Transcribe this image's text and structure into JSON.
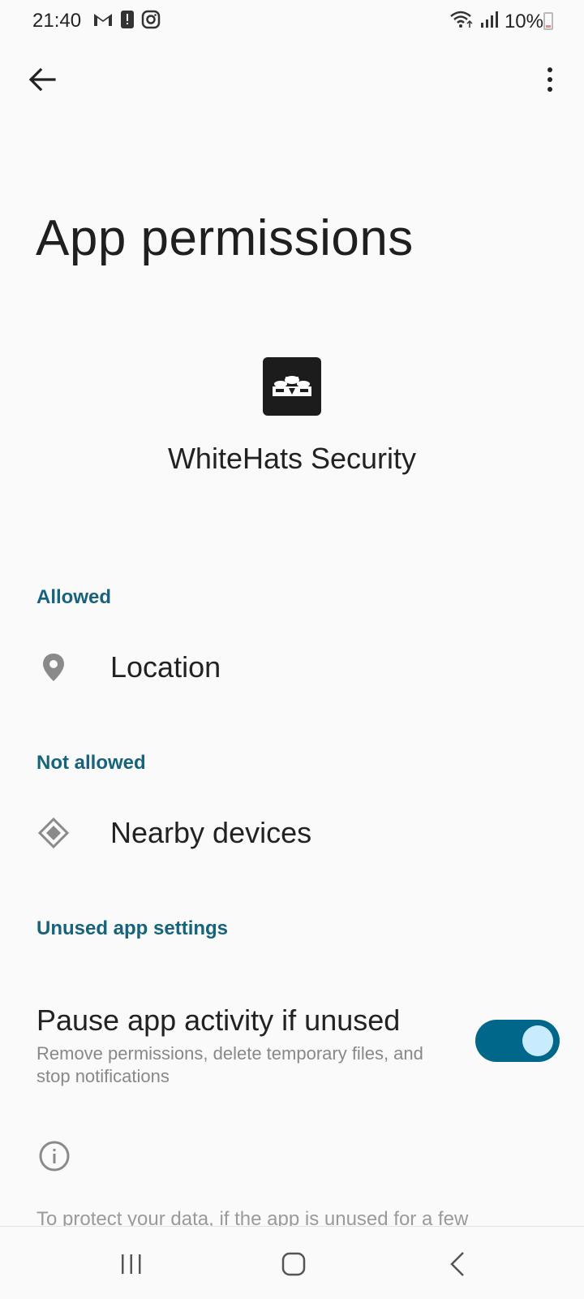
{
  "status_bar": {
    "time": "21:40",
    "battery_text": "10%",
    "left_icons": [
      "gmail-icon",
      "alert-icon",
      "instagram-icon"
    ],
    "right_icons": [
      "wifi-icon",
      "signal-icon",
      "battery-icon"
    ]
  },
  "top_bar": {
    "back_icon": "arrow-left-icon",
    "more_icon": "more-vertical-icon"
  },
  "page": {
    "title": "App permissions",
    "app_name": "WhiteHats Security"
  },
  "sections": {
    "allowed": {
      "header": "Allowed",
      "items": [
        {
          "label": "Location",
          "icon": "location-icon"
        }
      ]
    },
    "not_allowed": {
      "header": "Not allowed",
      "items": [
        {
          "label": "Nearby devices",
          "icon": "nearby-devices-icon"
        }
      ]
    },
    "unused": {
      "header": "Unused app settings",
      "toggle_title": "Pause app activity if unused",
      "toggle_subtitle": "Remove permissions, delete temporary files, and stop notifications",
      "toggle_on": true
    }
  },
  "info": {
    "icon": "info-icon",
    "text": "To protect your data, if the app is unused for a few"
  },
  "nav_bar": {
    "recents_icon": "recents-icon",
    "home_icon": "home-icon",
    "back_icon": "nav-back-icon"
  },
  "colors": {
    "accent": "#17627c",
    "toggle_track": "#00678a",
    "toggle_knob": "#c8ecfd",
    "background": "#fafafa"
  }
}
